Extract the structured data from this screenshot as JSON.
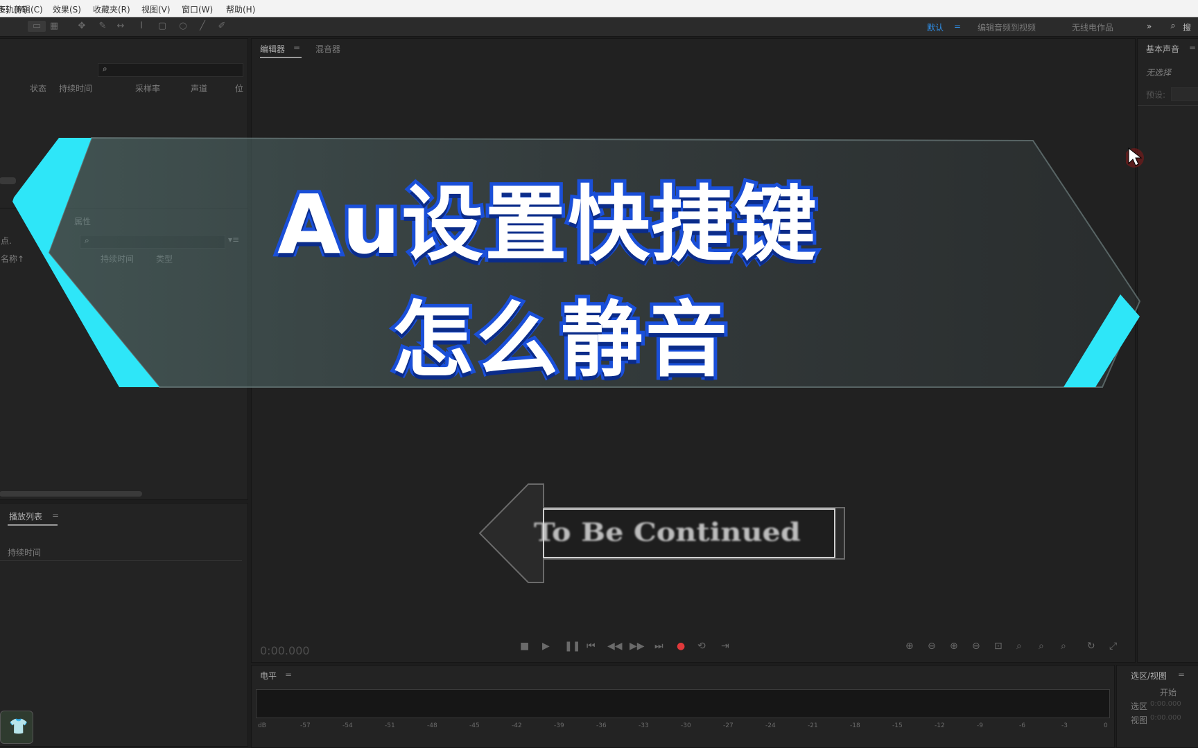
{
  "menu": [
    "编辑(E)",
    "多轨(M)",
    "剪辑(C)",
    "效果(S)",
    "收藏夹(R)",
    "视图(V)",
    "窗口(W)",
    "帮助(H)"
  ],
  "workspaces": {
    "active": "默认",
    "separator": "=",
    "items": [
      "编辑音频到视频",
      "无线电作品"
    ],
    "overflow": "»",
    "search_partial": "搜"
  },
  "files_panel": {
    "cols": [
      "状态",
      "持续时间",
      "采样率",
      "声道",
      "位"
    ]
  },
  "media_panel": {
    "tab": "属性",
    "cols": [
      "持续时间",
      "类型"
    ],
    "partial_left": "点.",
    "partial_left2": "名称↑"
  },
  "playlist_panel": {
    "title": "播放列表",
    "menu": "=",
    "col": "持续时间"
  },
  "editor": {
    "tabs": [
      "编辑器",
      "混音器"
    ],
    "menu": "=",
    "time": "0:00.000"
  },
  "essential_sound": {
    "title": "基本声音",
    "menu": "=",
    "status": "无选择",
    "preset": "预设:"
  },
  "levels_panel": {
    "title": "电平",
    "menu": "=",
    "ruler": [
      "dB",
      "-57",
      "-54",
      "-51",
      "-48",
      "-45",
      "-42",
      "-39",
      "-36",
      "-33",
      "-30",
      "-27",
      "-24",
      "-21",
      "-18",
      "-15",
      "-12",
      "-9",
      "-6",
      "-3",
      "0"
    ]
  },
  "selection_panel": {
    "title": "选区/视图",
    "menu": "=",
    "start": "开始",
    "row1": "选区",
    "row2": "视图",
    "value": "0:00.000"
  },
  "overlay": {
    "title_line1": "Au设置快捷键",
    "title_line2": "怎么静音",
    "continued": "To Be Continued"
  },
  "colors": {
    "accent_blue": "#2f8fe8",
    "banner_cyan": "#2ee6f8",
    "title_stroke": "#1a4fd8",
    "record_red": "#e0393b"
  }
}
